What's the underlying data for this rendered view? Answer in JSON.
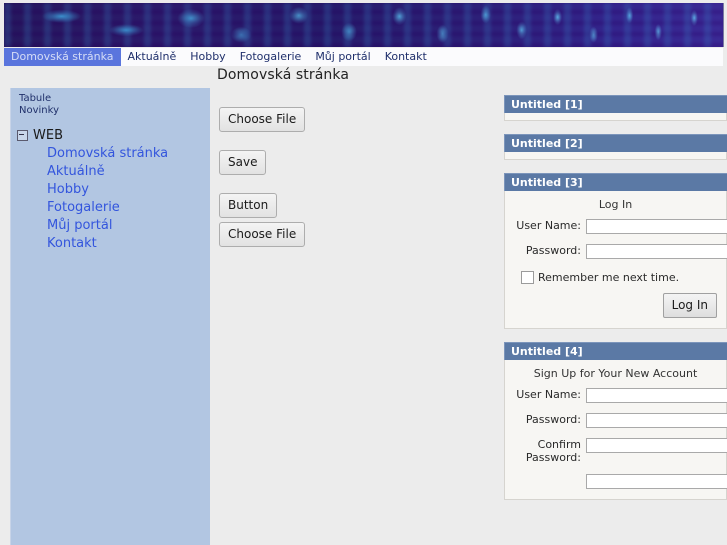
{
  "banner": {
    "alt": "binary-digits-banner"
  },
  "nav": {
    "items": [
      {
        "label": "Domovská stránka",
        "active": true
      },
      {
        "label": "Aktuálně",
        "active": false
      },
      {
        "label": "Hobby",
        "active": false
      },
      {
        "label": "Fotogalerie",
        "active": false
      },
      {
        "label": "Můj portál",
        "active": false
      },
      {
        "label": "Kontakt",
        "active": false
      }
    ]
  },
  "page": {
    "title": "Domovská stránka"
  },
  "sidebar": {
    "links": [
      {
        "label": "Tabule"
      },
      {
        "label": "Novinky"
      }
    ],
    "tree": {
      "root": "WEB",
      "expander": "minus-box-icon",
      "children": [
        {
          "label": "Domovská stránka"
        },
        {
          "label": "Aktuálně"
        },
        {
          "label": "Hobby"
        },
        {
          "label": "Fotogalerie"
        },
        {
          "label": "Můj portál"
        },
        {
          "label": "Kontakt"
        }
      ]
    }
  },
  "main": {
    "buttons": [
      {
        "label": "Choose File"
      },
      {
        "label": "Save"
      },
      {
        "label": "Button"
      },
      {
        "label": "Choose File"
      }
    ]
  },
  "panels": [
    {
      "title": "Untitled [1]",
      "empty": true
    },
    {
      "title": "Untitled [2]",
      "empty": true
    },
    {
      "title": "Untitled [3]",
      "form_title": "Log In",
      "fields": [
        {
          "label": "User Name:",
          "value": ""
        },
        {
          "label": "Password:",
          "value": ""
        }
      ],
      "checkbox_label": "Remember me next time.",
      "submit_label": "Log In"
    },
    {
      "title": "Untitled [4]",
      "form_title": "Sign Up for Your New Account",
      "fields": [
        {
          "label": "User Name:",
          "value": ""
        },
        {
          "label": "Password:",
          "value": ""
        },
        {
          "label": "Confirm Password:",
          "value": ""
        },
        {
          "label": "",
          "value": ""
        }
      ]
    }
  ],
  "colors": {
    "nav_active_bg": "#5a75dd",
    "sidebar_bg": "#b2c6e2",
    "panel_header_bg": "#5b79a5",
    "page_bg": "#ececec",
    "link": "#3355dd"
  }
}
